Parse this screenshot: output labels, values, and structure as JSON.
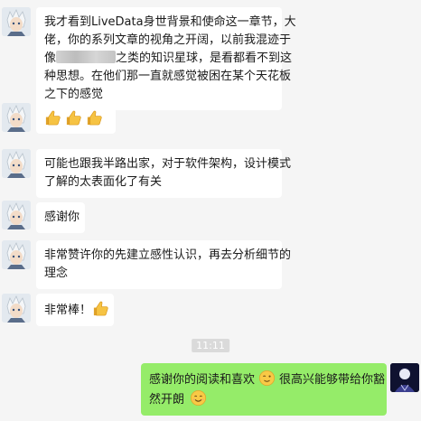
{
  "messages": [
    {
      "sender": "other",
      "lines": [
        "我才看到LiveData身世背景和使命这一章节，大",
        "佬，你的系列文章的视角之开阔，以前我混迹于",
        [
          "像",
          "[blurred]",
          "之类的知识星球，是看都看不到这"
        ],
        "种思想。在他们那一直就感觉被困在某个天花板",
        "之下的感觉"
      ],
      "line3_prefix": "像",
      "line3_suffix": "之类的知识星球，是看都看不到这"
    },
    {
      "sender": "other",
      "emoji": [
        "thumbs-up-icon",
        "thumbs-up-icon",
        "thumbs-up-icon"
      ]
    },
    {
      "sender": "other",
      "lines": [
        "可能也跟我半路出家，对于软件架构，设计模式",
        "了解的太表面化了有关"
      ]
    },
    {
      "sender": "other",
      "lines": [
        "感谢你"
      ]
    },
    {
      "sender": "other",
      "lines": [
        "非常赞许你的先建立感性认识，再去分析细节的",
        "理念"
      ]
    },
    {
      "sender": "other",
      "text": "非常棒！",
      "emoji": [
        "thumbs-up-icon"
      ]
    },
    {
      "sender": "me",
      "line1_a": "感谢你的阅读和喜欢",
      "line1_b": "很高兴能够带给你豁",
      "line2": "然开朗"
    }
  ],
  "timestamp": "11:11",
  "colors": {
    "background": "#f5f5f5",
    "bubble_other": "#ffffff",
    "bubble_me": "#95ec69",
    "timestamp_bg": "#dadada"
  }
}
